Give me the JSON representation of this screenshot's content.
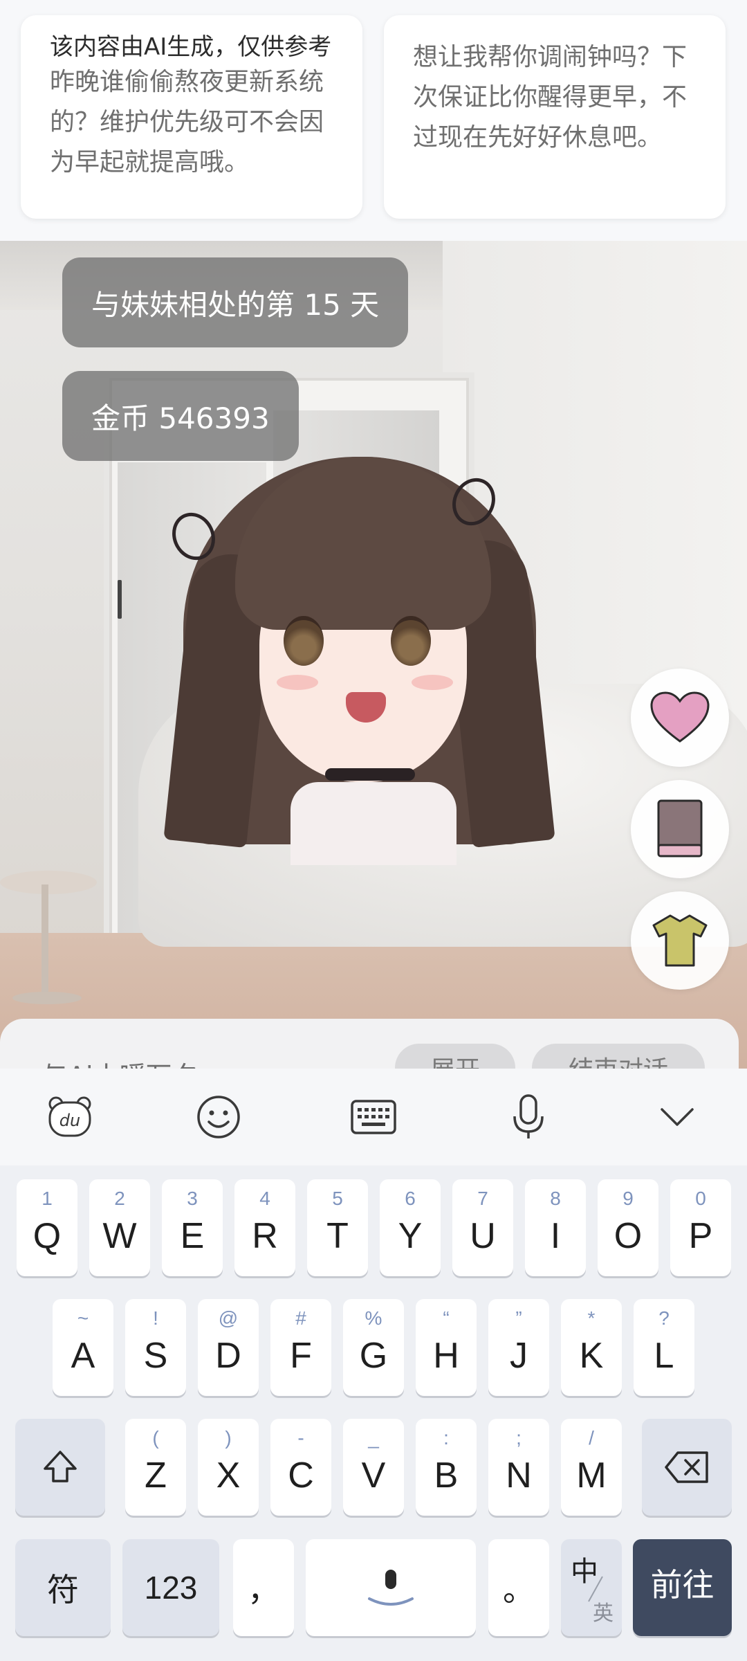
{
  "suggestions": {
    "ai_notice": "该内容由AI生成，仅供参考",
    "left_text": "昨晚谁偷偷熬夜更新系统的？维护优先级可不会因为早起就提高哦。",
    "right_text": "想让我帮你调闹钟吗？下次保证比你醒得更早，不过现在先好好休息吧。"
  },
  "status": {
    "days_label": "与妹妹相处的第 15 天",
    "coins_label": "金币 546393"
  },
  "chat": {
    "placeholder": "与Ai小嗳万夕",
    "expand_label": "展开",
    "end_label": "结束对话"
  },
  "keyboard": {
    "row1": [
      {
        "main": "Q",
        "sub": "1"
      },
      {
        "main": "W",
        "sub": "2"
      },
      {
        "main": "E",
        "sub": "3"
      },
      {
        "main": "R",
        "sub": "4"
      },
      {
        "main": "T",
        "sub": "5"
      },
      {
        "main": "Y",
        "sub": "6"
      },
      {
        "main": "U",
        "sub": "7"
      },
      {
        "main": "I",
        "sub": "8"
      },
      {
        "main": "O",
        "sub": "9"
      },
      {
        "main": "P",
        "sub": "0"
      }
    ],
    "row2": [
      {
        "main": "A",
        "sub": "~"
      },
      {
        "main": "S",
        "sub": "!"
      },
      {
        "main": "D",
        "sub": "@"
      },
      {
        "main": "F",
        "sub": "#"
      },
      {
        "main": "G",
        "sub": "%"
      },
      {
        "main": "H",
        "sub": "“"
      },
      {
        "main": "J",
        "sub": "”"
      },
      {
        "main": "K",
        "sub": "*"
      },
      {
        "main": "L",
        "sub": "?"
      }
    ],
    "row3": [
      {
        "main": "Z",
        "sub": "("
      },
      {
        "main": "X",
        "sub": ")"
      },
      {
        "main": "C",
        "sub": "-"
      },
      {
        "main": "V",
        "sub": "_"
      },
      {
        "main": "B",
        "sub": ":"
      },
      {
        "main": "N",
        "sub": ";"
      },
      {
        "main": "M",
        "sub": "/"
      }
    ],
    "symbols_label": "符",
    "numbers_label": "123",
    "comma_label": "，",
    "period_label": "。",
    "lang_cn": "中",
    "lang_en": "英",
    "go_label": "前往"
  },
  "colors": {
    "heart": "#e4a0c2",
    "book": "#8a7579",
    "shirt": "#c9c46a",
    "go_key": "#3f4a60"
  },
  "icons": {
    "toolbar": [
      "du-bear-icon",
      "emoji-icon",
      "keyboard-icon",
      "microphone-icon",
      "chevron-down-icon"
    ],
    "actions": [
      "heart-icon",
      "book-icon",
      "shirt-icon"
    ]
  }
}
